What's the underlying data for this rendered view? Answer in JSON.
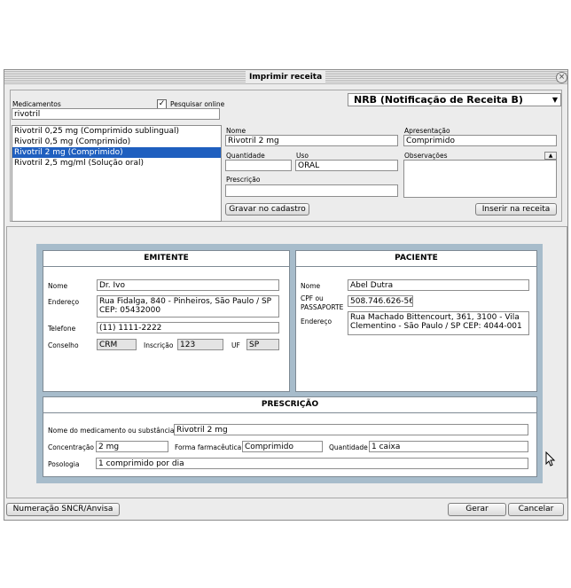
{
  "window": {
    "title": "Imprimir receita",
    "close_icon": "close-icon"
  },
  "top": {
    "medicamentos_label": "Medicamentos",
    "pesquisar_online_label": "Pesquisar online",
    "pesquisar_online_checked": true,
    "search_value": "rivotril",
    "receita_type": "NRB (Notificação de Receita B)",
    "results": [
      "Rivotril 0,25 mg (Comprimido sublingual)",
      "Rivotril 0,5 mg (Comprimido)",
      "Rivotril 2 mg (Comprimido)",
      "Rivotril 2,5 mg/ml (Solução oral)"
    ],
    "selected_index": 2,
    "nome_label": "Nome",
    "nome_value": "Rivotril 2 mg",
    "apresentacao_label": "Apresentação",
    "apresentacao_value": "Comprimido",
    "quantidade_label": "Quantidade",
    "quantidade_value": "",
    "uso_label": "Uso",
    "uso_value": "ORAL",
    "observacoes_label": "Observações",
    "observacoes_value": "",
    "prescricao_label": "Prescrição",
    "prescricao_value": "",
    "gravar_button": "Gravar no cadastro",
    "inserir_button": "Inserir na receita"
  },
  "emitente": {
    "heading": "EMITENTE",
    "nome_label": "Nome",
    "nome_value": "Dr. Ivo",
    "endereco_label": "Endereço",
    "endereco_value": "Rua Fidalga, 840 - Pinheiros, São Paulo / SP CEP: 05432000",
    "telefone_label": "Telefone",
    "telefone_value": "(11) 1111-2222",
    "conselho_label": "Conselho",
    "conselho_value": "CRM",
    "inscricao_label": "Inscrição",
    "inscricao_value": "123",
    "uf_label": "UF",
    "uf_value": "SP"
  },
  "paciente": {
    "heading": "PACIENTE",
    "nome_label": "Nome",
    "nome_value": "Abel Dutra",
    "cpf_label_1": "CPF ou",
    "cpf_label_2": "PASSAPORTE",
    "cpf_value": "508.746.626-56",
    "endereco_label": "Endereço",
    "endereco_value": "Rua Machado Bittencourt, 361, 3100 - Vila Clementino - São Paulo / SP CEP: 4044-001"
  },
  "prescricao": {
    "heading": "PRESCRIÇÃO",
    "nome_label": "Nome do medicamento ou substância",
    "nome_value": "Rivotril 2 mg",
    "concentracao_label": "Concentração",
    "concentracao_value": "2 mg",
    "forma_label": "Forma farmacêutica",
    "forma_value": "Comprimido",
    "quantidade_label": "Quantidade",
    "quantidade_value": "1 caixa",
    "posologia_label": "Posologia",
    "posologia_value": "1 comprimido por dia"
  },
  "footer": {
    "numeracao_button": "Numeração SNCR/Anvisa",
    "gerar_button": "Gerar",
    "cancelar_button": "Cancelar"
  }
}
